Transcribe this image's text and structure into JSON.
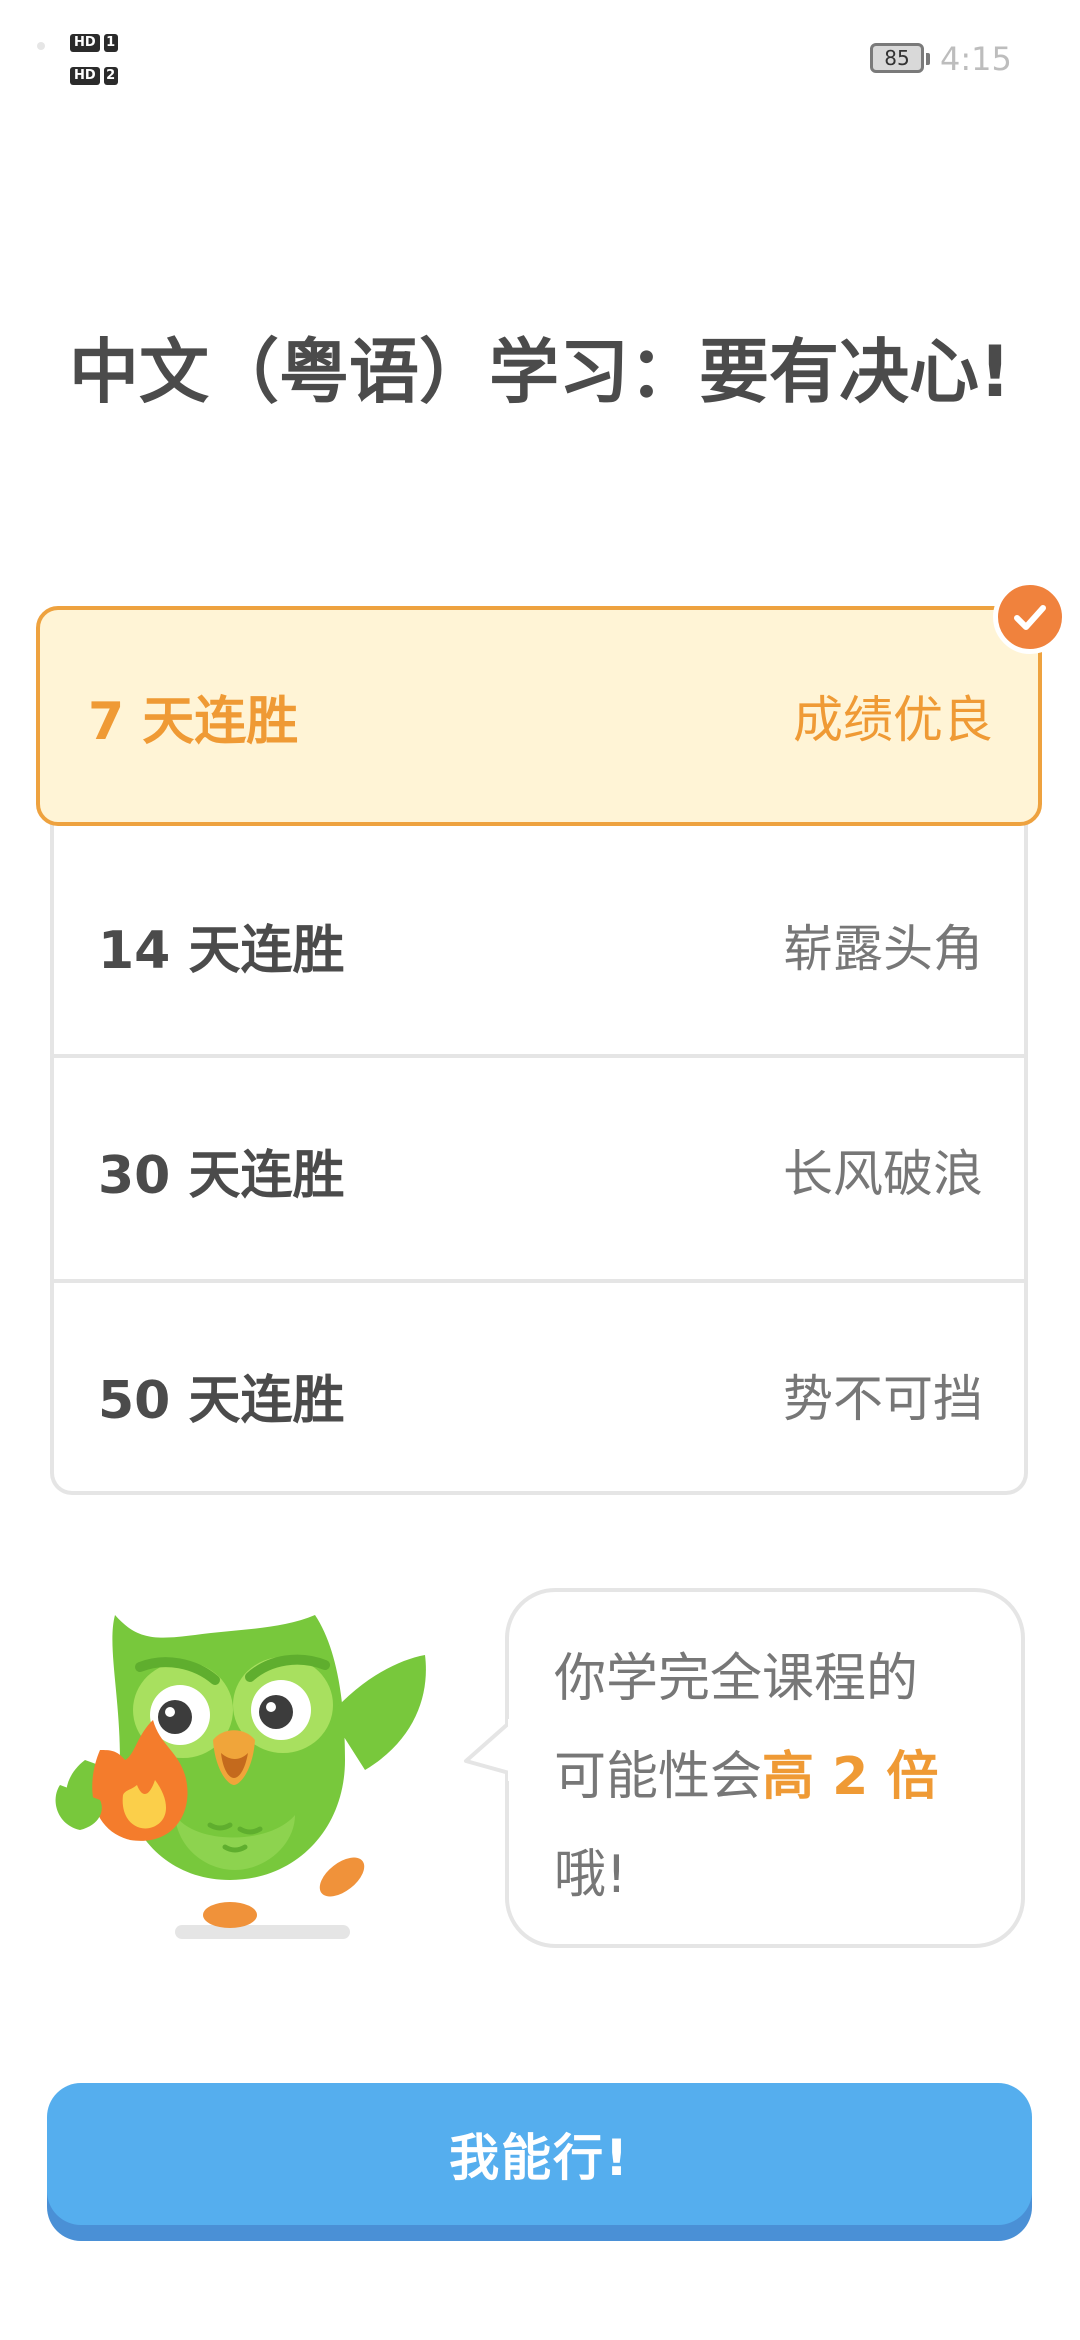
{
  "status_bar": {
    "hd1": "HD",
    "hd1_num": "1",
    "hd2": "HD",
    "hd2_num": "2",
    "battery": "85",
    "time": "4:15"
  },
  "title": "中文（粤语）学习：要有决心!",
  "options": [
    {
      "label": "7 天连胜",
      "tag": "成绩优良",
      "selected": true
    },
    {
      "label": "14 天连胜",
      "tag": "崭露头角",
      "selected": false
    },
    {
      "label": "30 天连胜",
      "tag": "长风破浪",
      "selected": false
    },
    {
      "label": "50 天连胜",
      "tag": "势不可挡",
      "selected": false
    }
  ],
  "bubble": {
    "line1": "你学完全课程的",
    "line2_prefix": "可能性会",
    "line2_highlight": "高 2 倍",
    "line3": "哦!"
  },
  "cta_label": "我能行!",
  "colors": {
    "accent_orange": "#ef9a35",
    "selected_bg": "#fff4d6",
    "button_blue": "#55aeee",
    "owl_green": "#78c83c"
  }
}
